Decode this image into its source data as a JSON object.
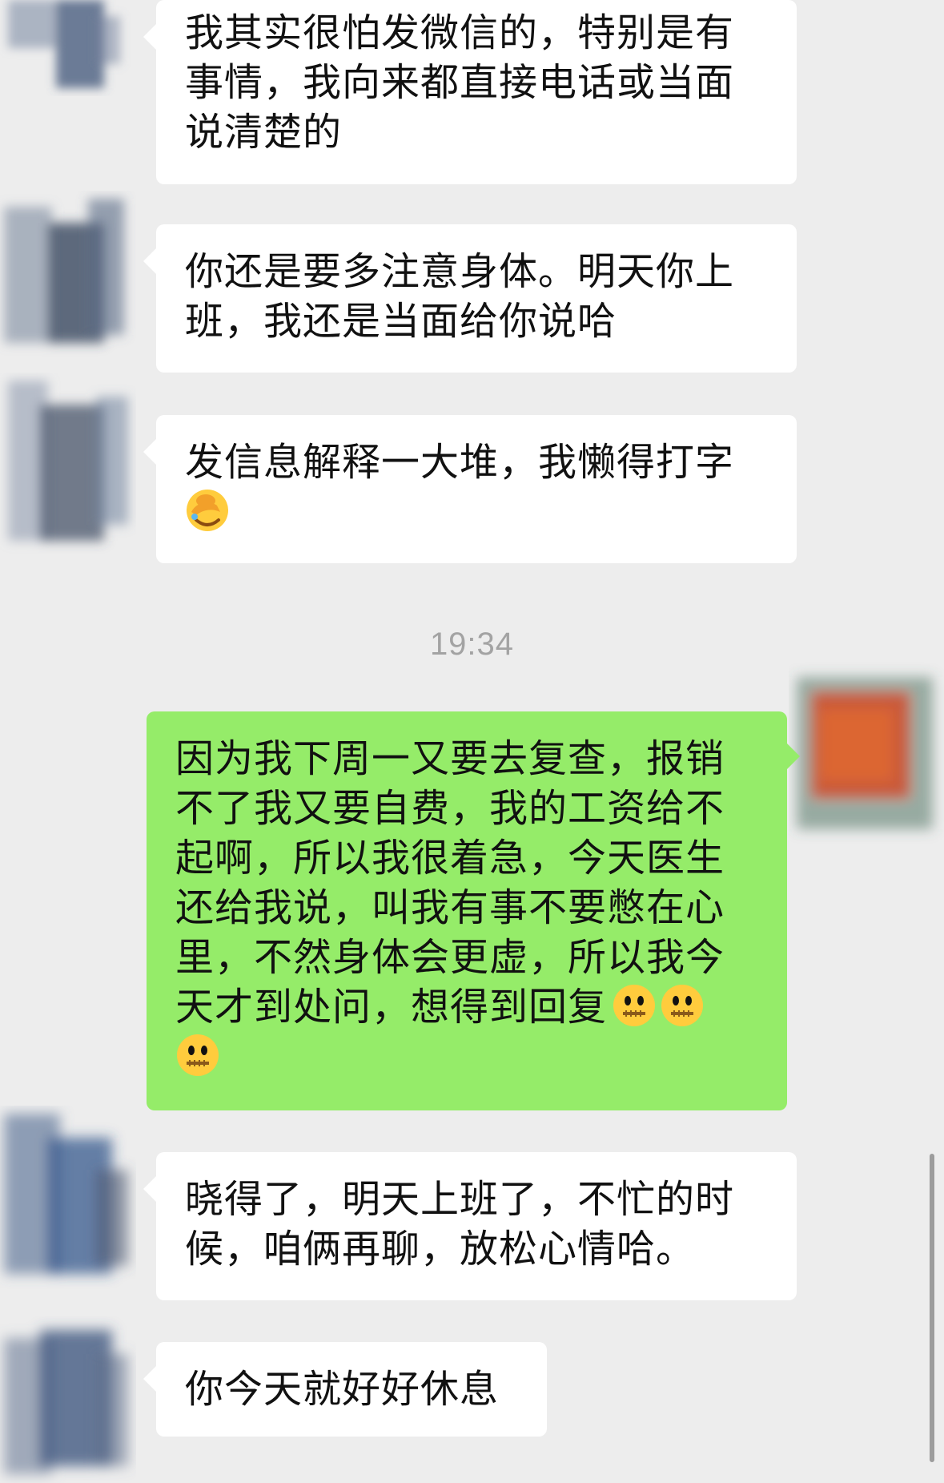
{
  "chat": {
    "messages": [
      {
        "side": "left",
        "text": "我其实很怕发微信的，特别是有事情，我向来都直接电话或当面说清楚的"
      },
      {
        "side": "left",
        "text": "你还是要多注意身体。明天你上班，我还是当面给你说哈"
      },
      {
        "side": "left",
        "text": "发信息解释一大堆，我懒得打字",
        "emoji": [
          "facepalm-emoji"
        ]
      },
      {
        "side": "right",
        "text": "因为我下周一又要去复查，报销不了我又要自费，我的工资给不起啊，所以我很着急，今天医生还给我说，叫我有事不要憋在心里，不然身体会更虚，所以我今天才到处问，想得到回复",
        "emoji": [
          "zipper-mouth-emoji",
          "zipper-mouth-emoji",
          "zipper-mouth-emoji"
        ]
      },
      {
        "side": "left",
        "text": "晓得了，明天上班了，不忙的时候，咱俩再聊，放松心情哈。"
      },
      {
        "side": "left",
        "text": "你今天就好好休息"
      }
    ],
    "timestamp": "19:34"
  },
  "colors": {
    "background": "#ededed",
    "incoming_bubble": "#ffffff",
    "outgoing_bubble": "#95ec69",
    "timestamp_text": "#a3a3a3"
  }
}
